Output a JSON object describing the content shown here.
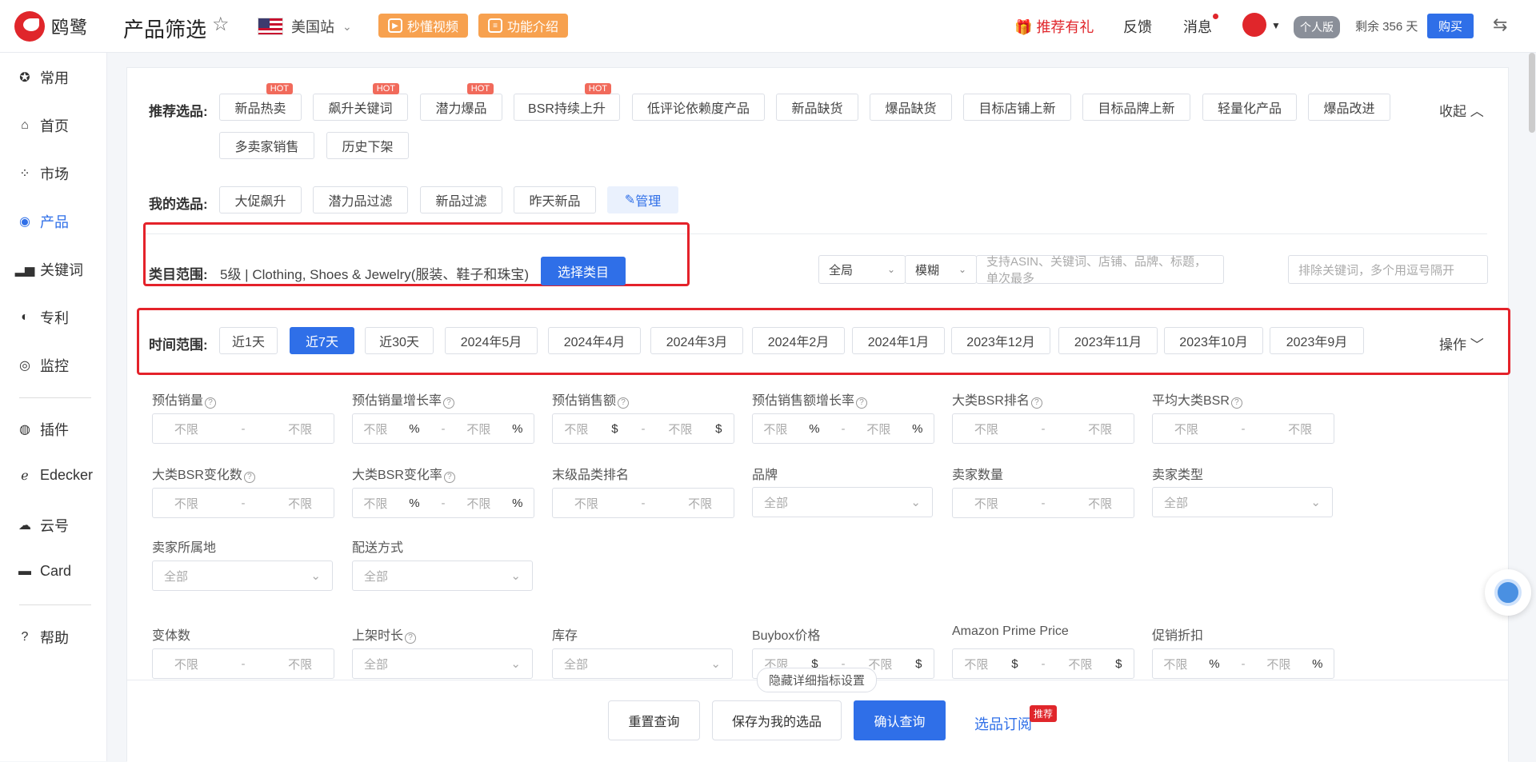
{
  "app": {
    "logo_text": "鸥鹭",
    "page_title": "产品筛选",
    "site": "美国站"
  },
  "top_buttons": {
    "video": "秒懂视频",
    "intro": "功能介绍"
  },
  "top_right": {
    "gift": "推荐有礼",
    "feedback": "反馈",
    "message": "消息",
    "plan": "个人版",
    "remain": "剩余 356 天",
    "buy": "购买"
  },
  "sidebar": [
    {
      "label": "常用",
      "icon": "star-icon"
    },
    {
      "label": "首页",
      "icon": "home-icon"
    },
    {
      "label": "市场",
      "icon": "grid-icon"
    },
    {
      "label": "产品",
      "icon": "eye-icon"
    },
    {
      "label": "关键词",
      "icon": "bar-chart-icon"
    },
    {
      "label": "专利",
      "icon": "patent-icon"
    },
    {
      "label": "监控",
      "icon": "monitor-icon"
    },
    {
      "label": "插件",
      "icon": "chrome-icon"
    },
    {
      "label": "Edecker",
      "icon": "edecker-icon"
    },
    {
      "label": "云号",
      "icon": "cloud-icon"
    },
    {
      "label": "Card",
      "icon": "card-icon"
    },
    {
      "label": "帮助",
      "icon": "help-icon"
    }
  ],
  "recommend": {
    "label": "推荐选品:",
    "collapse": "收起",
    "hot": "HOT",
    "items": [
      "新品热卖",
      "飙升关键词",
      "潜力爆品",
      "BSR持续上升",
      "低评论依赖度产品",
      "新品缺货",
      "爆品缺货",
      "目标店铺上新",
      "目标品牌上新",
      "轻量化产品",
      "爆品改进",
      "多卖家销售",
      "历史下架"
    ]
  },
  "mine": {
    "label": "我的选品:",
    "items": [
      "大促飙升",
      "潜力品过滤",
      "新品过滤",
      "昨天新品"
    ],
    "manage": "管理"
  },
  "category": {
    "label": "类目范围:",
    "value": "5级 | Clothing, Shoes & Jewelry(服装、鞋子和珠宝)",
    "button": "选择类目"
  },
  "search": {
    "scope": "全局",
    "match": "模糊",
    "placeholder": "支持ASIN、关键词、店铺、品牌、标题，单次最多",
    "exclude_placeholder": "排除关键词，多个用逗号隔开"
  },
  "time": {
    "label": "时间范围:",
    "items": [
      "近1天",
      "近7天",
      "近30天",
      "2024年5月",
      "2024年4月",
      "2024年3月",
      "2024年2月",
      "2024年1月",
      "2023年12月",
      "2023年11月",
      "2023年10月",
      "2023年9月"
    ],
    "active": "近7天",
    "operate": "操作"
  },
  "filters": {
    "unlimited": "不限",
    "all": "全部",
    "row1": [
      "预估销量",
      "预估销量增长率",
      "预估销售额",
      "预估销售额增长率",
      "大类BSR排名",
      "平均大类BSR"
    ],
    "row2": [
      "大类BSR变化数",
      "大类BSR变化率",
      "末级品类排名",
      "品牌",
      "卖家数量",
      "卖家类型"
    ],
    "row3": [
      "卖家所属地",
      "配送方式"
    ],
    "row4": [
      "变体数",
      "上架时长",
      "库存",
      "Buybox价格",
      "Amazon Prime Price",
      "促销折扣"
    ]
  },
  "footer": {
    "hide": "隐藏详细指标设置",
    "reset": "重置查询",
    "save": "保存为我的选品",
    "confirm": "确认查询",
    "subscribe": "选品订阅",
    "recommend_badge": "推荐"
  }
}
